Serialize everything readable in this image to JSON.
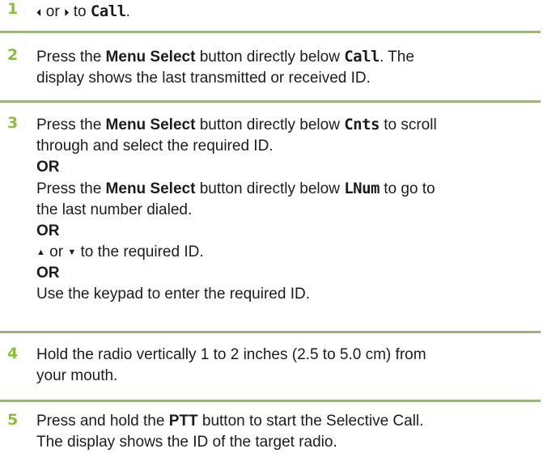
{
  "steps": [
    {
      "num": "1",
      "left_nav": "⏴",
      "or_text": " or ",
      "right_nav": "⏵",
      "to_text": " to ",
      "lcd_call": "Call",
      "end": "."
    },
    {
      "num": "2",
      "press": "Press the ",
      "menu_select": "Menu Select",
      "directly_below": " button directly below ",
      "lcd_call": "Call",
      "after": ". The",
      "line2": "display shows the last transmitted or received ID."
    },
    {
      "num": "3",
      "press": "Press the ",
      "menu_select": "Menu Select",
      "directly_below": " button directly below ",
      "lcd_cnts": "Cnts",
      "after_cnts": " to scroll",
      "line2": "through and select the required ID.",
      "or1": "OR",
      "press2": "Press the ",
      "menu_select2": "Menu Select",
      "directly_below2": " button directly below ",
      "lcd_lnum": "LNum",
      "after_lnum": " to go to",
      "line4": "the last number dialed.",
      "or2": "OR",
      "up_arrow": "▲",
      "or_mid": " or ",
      "down_arrow": "▼",
      "to_required": " to the required ID.",
      "or3": "OR",
      "keypad": "Use the keypad to enter the required ID."
    },
    {
      "num": "4",
      "line1": "Hold the radio vertically 1 to 2 inches (2.5 to 5.0 cm) from",
      "line2": "your mouth."
    },
    {
      "num": "5",
      "press": "Press and hold the ",
      "ptt": "PTT",
      "after": " button to start the Selective Call.",
      "line2": "The display shows the ID of the target radio."
    }
  ],
  "colors": {
    "step_number": "#8cbe3c",
    "rule": "#9fb37c",
    "text": "#1c1c1c"
  }
}
